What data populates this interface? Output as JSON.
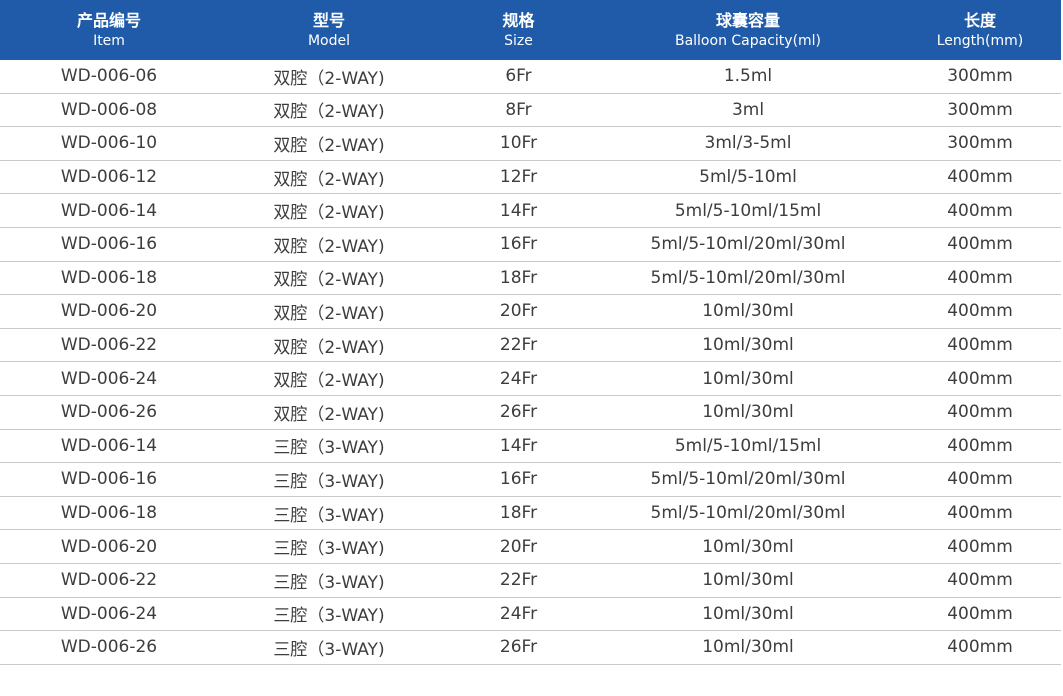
{
  "table": {
    "header_bg": "#1f5ba8",
    "headers": [
      {
        "zh": "产品编号",
        "en": "Item"
      },
      {
        "zh": "型号",
        "en": "Model"
      },
      {
        "zh": "规格",
        "en": "Size"
      },
      {
        "zh": "球囊容量",
        "en": "Balloon Capacity(ml)"
      },
      {
        "zh": "长度",
        "en": "Length(mm)"
      }
    ],
    "rows": [
      [
        "WD-006-06",
        "双腔（2-WAY)",
        "6Fr",
        "1.5ml",
        "300mm"
      ],
      [
        "WD-006-08",
        "双腔（2-WAY)",
        "8Fr",
        "3ml",
        "300mm"
      ],
      [
        "WD-006-10",
        "双腔（2-WAY)",
        "10Fr",
        "3ml/3-5ml",
        "300mm"
      ],
      [
        "WD-006-12",
        "双腔（2-WAY)",
        "12Fr",
        "5ml/5-10ml",
        "400mm"
      ],
      [
        "WD-006-14",
        "双腔（2-WAY)",
        "14Fr",
        "5ml/5-10ml/15ml",
        "400mm"
      ],
      [
        "WD-006-16",
        "双腔（2-WAY)",
        "16Fr",
        "5ml/5-10ml/20ml/30ml",
        "400mm"
      ],
      [
        "WD-006-18",
        "双腔（2-WAY)",
        "18Fr",
        "5ml/5-10ml/20ml/30ml",
        "400mm"
      ],
      [
        "WD-006-20",
        "双腔（2-WAY)",
        "20Fr",
        "10ml/30ml",
        "400mm"
      ],
      [
        "WD-006-22",
        "双腔（2-WAY)",
        "22Fr",
        "10ml/30ml",
        "400mm"
      ],
      [
        "WD-006-24",
        "双腔（2-WAY)",
        "24Fr",
        "10ml/30ml",
        "400mm"
      ],
      [
        "WD-006-26",
        "双腔（2-WAY)",
        "26Fr",
        "10ml/30ml",
        "400mm"
      ],
      [
        "WD-006-14",
        "三腔（3-WAY)",
        "14Fr",
        "5ml/5-10ml/15ml",
        "400mm"
      ],
      [
        "WD-006-16",
        "三腔（3-WAY)",
        "16Fr",
        "5ml/5-10ml/20ml/30ml",
        "400mm"
      ],
      [
        "WD-006-18",
        "三腔（3-WAY)",
        "18Fr",
        "5ml/5-10ml/20ml/30ml",
        "400mm"
      ],
      [
        "WD-006-20",
        "三腔（3-WAY)",
        "20Fr",
        "10ml/30ml",
        "400mm"
      ],
      [
        "WD-006-22",
        "三腔（3-WAY)",
        "22Fr",
        "10ml/30ml",
        "400mm"
      ],
      [
        "WD-006-24",
        "三腔（3-WAY)",
        "24Fr",
        "10ml/30ml",
        "400mm"
      ],
      [
        "WD-006-26",
        "三腔（3-WAY)",
        "26Fr",
        "10ml/30ml",
        "400mm"
      ]
    ]
  }
}
